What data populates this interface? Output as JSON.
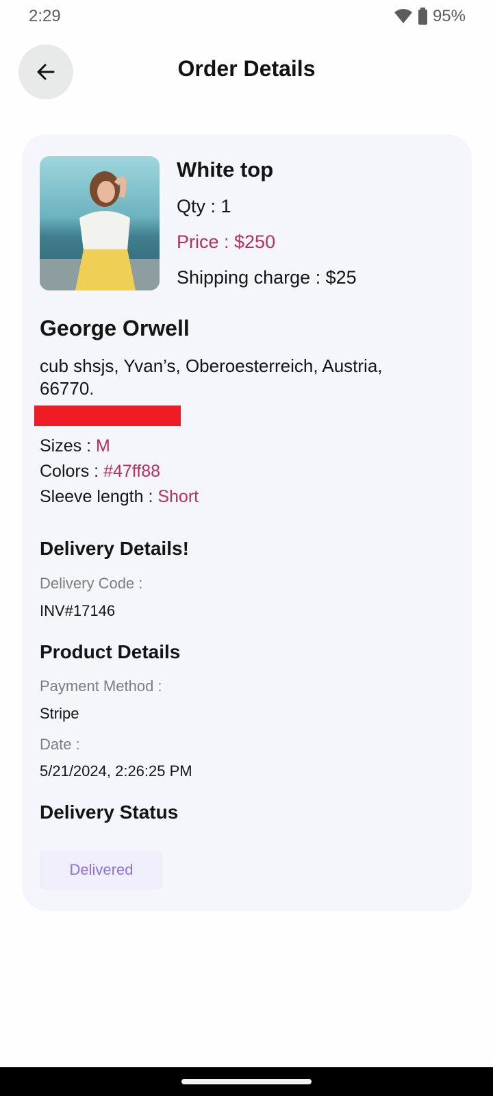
{
  "status_bar": {
    "time": "2:29",
    "battery": "95%"
  },
  "header": {
    "title": "Order Details"
  },
  "product": {
    "name": "White top",
    "qty": "Qty : 1",
    "price": "Price : $250",
    "shipping": "Shipping charge : $25"
  },
  "customer": {
    "name": "George Orwell",
    "address": "cub shsjs, Yvan’s, Oberoesterreich, Austria, 66770."
  },
  "attributes": [
    {
      "label": "Sizes : ",
      "value": "M"
    },
    {
      "label": "Colors : ",
      "value": "#47ff88"
    },
    {
      "label": "Sleeve length : ",
      "value": "Short"
    }
  ],
  "delivery_details": {
    "title": "Delivery Details!",
    "code_label": "Delivery Code :",
    "code_value": "INV#17146"
  },
  "product_details": {
    "title": "Product Details",
    "payment_label": "Payment Method :",
    "payment_value": "Stripe",
    "date_label": "Date :",
    "date_value": "5/21/2024, 2:26:25 PM"
  },
  "delivery_status": {
    "title": "Delivery Status",
    "status": "Delivered"
  },
  "colors": {
    "accent": "#b52f62",
    "status_text": "#8d72e0",
    "status_bg": "#f1eefc",
    "redaction": "#ee1c25"
  },
  "icons": {
    "back": "arrow-left-icon",
    "wifi": "wifi-icon",
    "battery": "battery-icon"
  }
}
